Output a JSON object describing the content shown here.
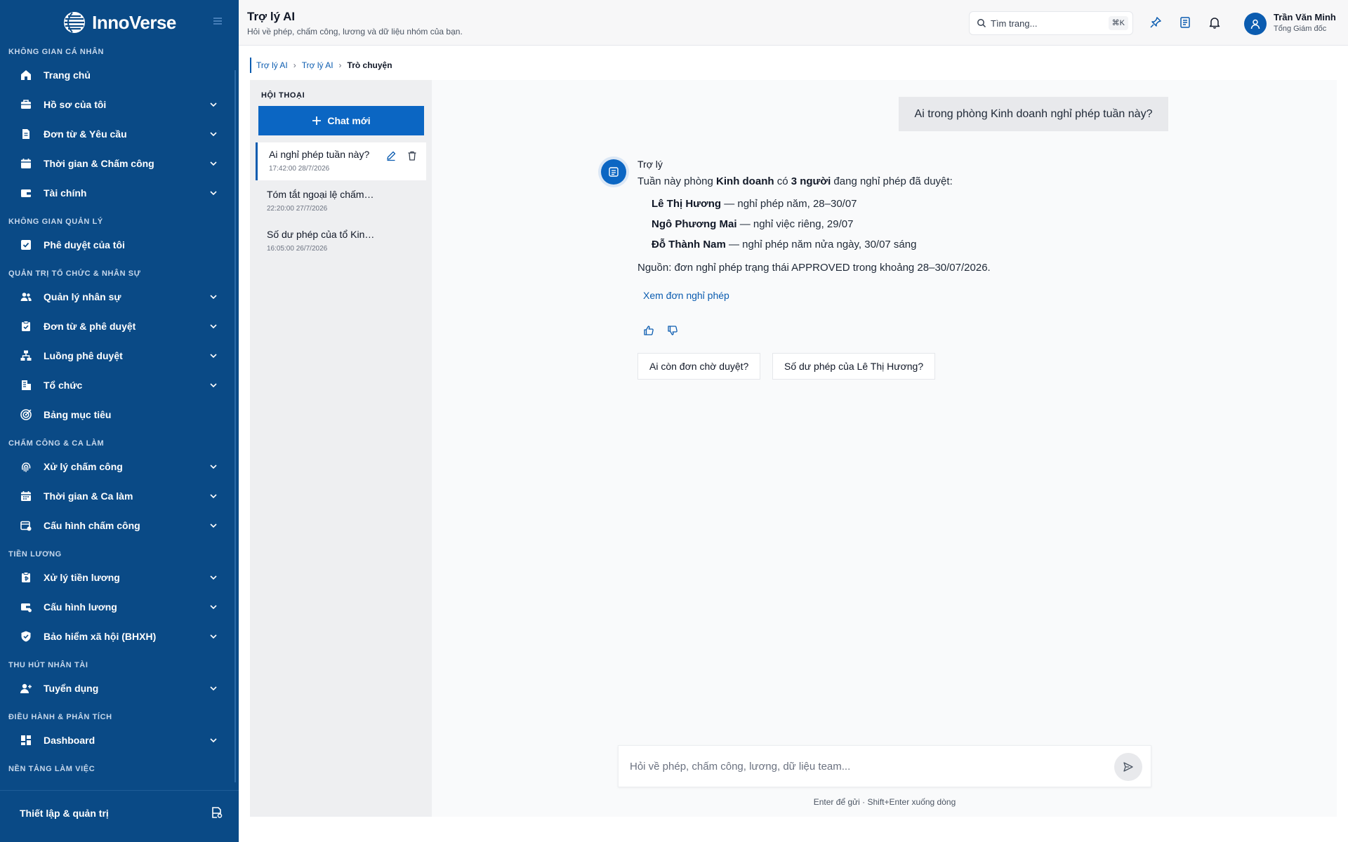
{
  "brand": {
    "name": "InnoVerse"
  },
  "colors": {
    "sidebar": "#0a4a86",
    "accent": "#0b66c3",
    "link": "#0b5cb0"
  },
  "sidebar": {
    "sections": [
      {
        "title": "KHÔNG GIAN CÁ NHÂN",
        "items": [
          {
            "label": "Trang chủ",
            "icon": "home-icon",
            "expandable": false
          },
          {
            "label": "Hồ sơ của tôi",
            "icon": "briefcase-icon",
            "expandable": true
          },
          {
            "label": "Đơn từ & Yêu cầu",
            "icon": "document-icon",
            "expandable": true
          },
          {
            "label": "Thời gian & Chấm công",
            "icon": "calendar-icon",
            "expandable": true
          },
          {
            "label": "Tài chính",
            "icon": "wallet-icon",
            "expandable": true
          }
        ]
      },
      {
        "title": "KHÔNG GIAN QUẢN LÝ",
        "items": [
          {
            "label": "Phê duyệt của tôi",
            "icon": "check-square-icon",
            "expandable": false
          }
        ]
      },
      {
        "title": "QUẢN TRỊ TỔ CHỨC & NHÂN SỰ",
        "items": [
          {
            "label": "Quản lý nhân sự",
            "icon": "users-icon",
            "expandable": true
          },
          {
            "label": "Đơn từ & phê duyệt",
            "icon": "clipboard-check-icon",
            "expandable": true
          },
          {
            "label": "Luồng phê duyệt",
            "icon": "workflow-icon",
            "expandable": true
          },
          {
            "label": "Tổ chức",
            "icon": "building-icon",
            "expandable": true
          },
          {
            "label": "Bảng mục tiêu",
            "icon": "target-icon",
            "expandable": false
          }
        ]
      },
      {
        "title": "CHẤM CÔNG & CA LÀM",
        "items": [
          {
            "label": "Xử lý chấm công",
            "icon": "fingerprint-icon",
            "expandable": true
          },
          {
            "label": "Thời gian & Ca làm",
            "icon": "calendar-grid-icon",
            "expandable": true
          },
          {
            "label": "Cấu hình chấm công",
            "icon": "calendar-settings-icon",
            "expandable": true
          }
        ]
      },
      {
        "title": "TIỀN LƯƠNG",
        "items": [
          {
            "label": "Xử lý tiền lương",
            "icon": "payroll-icon",
            "expandable": true
          },
          {
            "label": "Cấu hình lương",
            "icon": "wallet-settings-icon",
            "expandable": true
          },
          {
            "label": "Bảo hiểm xã hội (BHXH)",
            "icon": "shield-check-icon",
            "expandable": true
          }
        ]
      },
      {
        "title": "THU HÚT NHÂN TÀI",
        "items": [
          {
            "label": "Tuyển dụng",
            "icon": "user-plus-icon",
            "expandable": true
          }
        ]
      },
      {
        "title": "ĐIỀU HÀNH & PHÂN TÍCH",
        "items": [
          {
            "label": "Dashboard",
            "icon": "dashboard-icon",
            "expandable": true
          }
        ]
      },
      {
        "title": "NỀN TẢNG LÀM VIỆC",
        "items": []
      }
    ],
    "footer": {
      "label": "Thiết lập & quản trị",
      "icon": "settings-file-icon"
    }
  },
  "header": {
    "title": "Trợ lý AI",
    "subtitle": "Hỏi về phép, chấm công, lương và dữ liệu nhóm của bạn.",
    "search_placeholder": "Tìm trang...",
    "search_shortcut": "⌘K",
    "user_name": "Trần Văn Minh",
    "user_role": "Tổng Giám đốc"
  },
  "breadcrumb": {
    "items": [
      "Trợ lý AI",
      "Trợ lý AI"
    ],
    "current": "Trò chuyện"
  },
  "conversations": {
    "heading": "HỘI THOẠI",
    "new_chat_label": "Chat mới",
    "items": [
      {
        "title": "Ai nghỉ phép tuần này?",
        "date": "17:42:00 28/7/2026",
        "active": true
      },
      {
        "title": "Tóm tắt ngoại lệ chấm công",
        "date": "22:20:00 27/7/2026",
        "active": false
      },
      {
        "title": "Số dư phép của tổ Kinh doanh",
        "date": "16:05:00 26/7/2026",
        "active": false
      }
    ]
  },
  "chat": {
    "user_message": "Ai trong phòng Kinh doanh nghỉ phép tuần này?",
    "assistant_name": "Trợ lý",
    "intro": {
      "p1": "Tuần này phòng ",
      "dept": "Kinh doanh",
      "p2": " có ",
      "count": "3 người",
      "p3": " đang nghỉ phép đã duyệt:"
    },
    "list": [
      {
        "name": "Lê Thị Hương",
        "detail": " — nghỉ phép năm, 28–30/07"
      },
      {
        "name": "Ngô Phương Mai",
        "detail": " — nghỉ việc riêng, 29/07"
      },
      {
        "name": "Đỗ Thành Nam",
        "detail": " — nghỉ phép năm nửa ngày, 30/07 sáng"
      }
    ],
    "source": "Nguồn: đơn nghỉ phép trạng thái APPROVED trong khoảng 28–30/07/2026.",
    "link_label": "Xem đơn nghỉ phép",
    "suggestions": [
      "Ai còn đơn chờ duyệt?",
      "Số dư phép của Lê Thị Hương?"
    ]
  },
  "composer": {
    "placeholder": "Hỏi về phép, chấm công, lương, dữ liệu team...",
    "hint": "Enter để gửi · Shift+Enter xuống dòng"
  }
}
